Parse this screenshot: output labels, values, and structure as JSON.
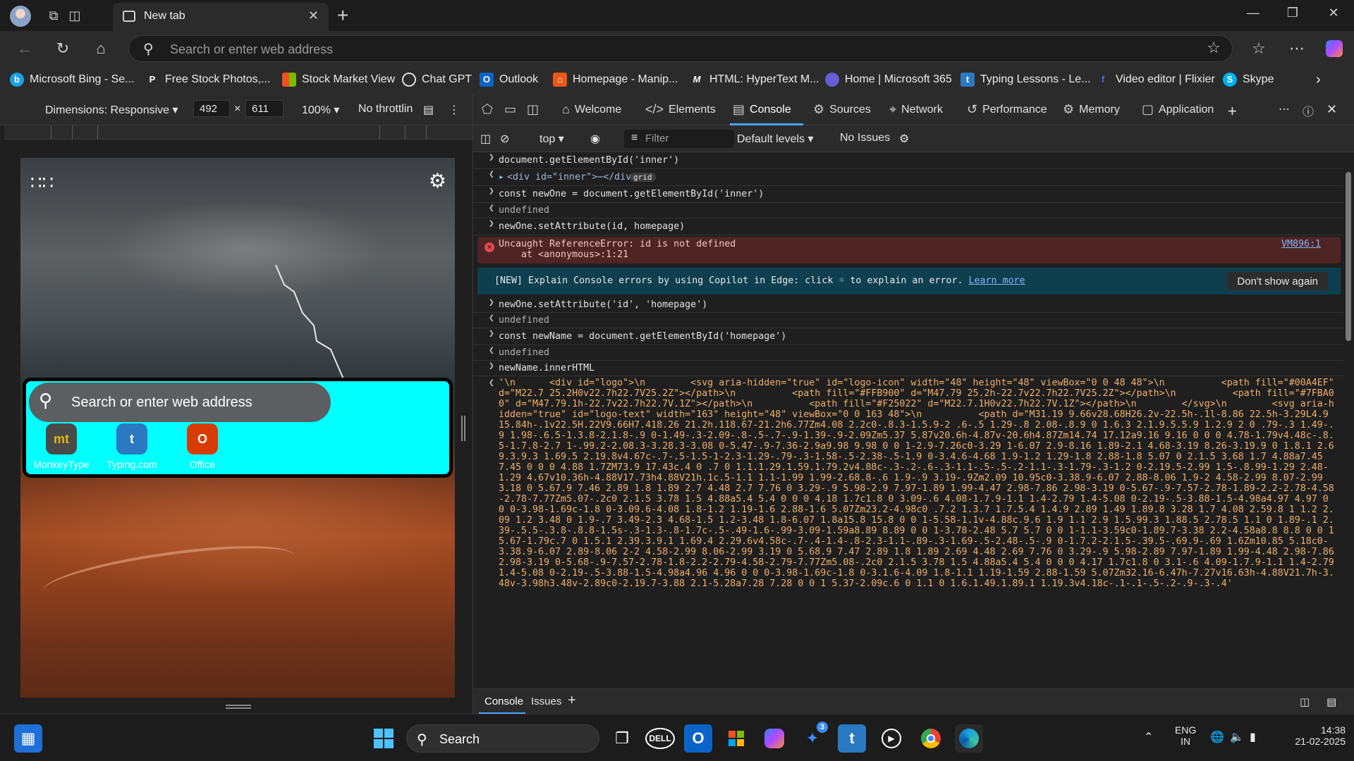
{
  "browser": {
    "tab_title": "New tab",
    "address_placeholder": "Search or enter web address"
  },
  "favorites": [
    {
      "label": "Microsoft Bing - Se...",
      "icon": "bing-icon",
      "color": "#1aa0e8"
    },
    {
      "label": "Free Stock Photos,...",
      "icon": "pexels-icon",
      "color": "#ffffff"
    },
    {
      "label": "Stock Market View",
      "icon": "microsoft-icon",
      "color": "#f25022"
    },
    {
      "label": "Chat GPT",
      "icon": "openai-icon",
      "color": "#ffffff"
    },
    {
      "label": "Outlook",
      "icon": "outlook-icon",
      "color": "#0a64c8"
    },
    {
      "label": "Homepage - Manip...",
      "icon": "homepage-icon",
      "color": "#e8591a"
    },
    {
      "label": "HTML: HyperText M...",
      "icon": "mdn-icon",
      "color": "#000000"
    },
    {
      "label": "Home | Microsoft 365",
      "icon": "m365-icon",
      "color": "#6b5bd6"
    },
    {
      "label": "Typing Lessons - Le...",
      "icon": "typing-icon",
      "color": "#2b79c2"
    },
    {
      "label": "Video editor | Flixier",
      "icon": "flixier-icon",
      "color": "#3b6cf6"
    },
    {
      "label": "Skype",
      "icon": "skype-icon",
      "color": "#00aff0"
    }
  ],
  "device_toolbar": {
    "dimensions_label": "Dimensions: Responsive",
    "width": "492",
    "height": "611",
    "zoom": "100%",
    "throttle": "No throttlin"
  },
  "newtab_page": {
    "search_placeholder": "Search or enter web address",
    "shortcuts": [
      {
        "label": "MonkeyType",
        "glyph": "mt",
        "color": "#e2b714"
      },
      {
        "label": "Typing.com",
        "glyph": "t",
        "color": "#2b79c2"
      },
      {
        "label": "Office",
        "glyph": "O",
        "color": "#d83b01"
      }
    ]
  },
  "devtools": {
    "tabs": [
      "Welcome",
      "Elements",
      "Console",
      "Sources",
      "Network",
      "Performance",
      "Memory",
      "Application"
    ],
    "active_tab": "Console",
    "context": "top",
    "filter_placeholder": "Filter",
    "levels": "Default levels",
    "issues": "No Issues",
    "drawer_tabs": [
      "Console",
      "Issues"
    ],
    "accent": "#4aa3ff"
  },
  "console": {
    "line1": "document.getElementById('inner')",
    "line2": "<div id=\"inner\">⋯</div>",
    "line2_badge": "grid",
    "line3": "const newOne = document.getElementById('inner')",
    "undefined": "undefined",
    "line5": "newOne.setAttribute(id, homepage)",
    "error_msg": "Uncaught ReferenceError: id is not defined",
    "error_at": "    at <anonymous>:1:21",
    "error_link": "VM896:1",
    "copilot_text": "[NEW] Explain Console errors by using Copilot in Edge: click",
    "copilot_text2": "to explain an error.",
    "copilot_link": "Learn more",
    "copilot_button": "Don't show again",
    "line7": "newOne.setAttribute('id', 'homepage')",
    "line9": "const newName = document.getElementById('homepage')",
    "line11": "newName.innerHTML",
    "output": "'\\n      <div id=\"logo\">\\n        <svg aria-hidden=\"true\" id=\"logo-icon\" width=\"48\" height=\"48\" viewBox=\"0 0 48 48\">\\n          <path fill=\"#00A4EF\" d=\"M22.7 25.2H0v22.7h22.7V25.2Z\"></path>\\n          <path fill=\"#FFB900\" d=\"M47.79 25.2h-22.7v22.7h22.7V25.2Z\"></path>\\n          <path fill=\"#7FBA00\" d=\"M47.79.1h-22.7v22.7h22.7V.1Z\"></path>\\n          <path fill=\"#F25022\" d=\"M22.7.1H0v22.7h22.7V.1Z\"></path>\\n        </svg>\\n        <svg aria-hidden=\"true\" id=\"logo-text\" width=\"163\" height=\"48\" viewBox=\"0 0 163 48\">\\n          <path d=\"M31.19 9.66v28.68H26.2v-22.5h-.1l-8.86 22.5h-3.29L4.9 15.84h-.1v22.5H.22V9.66H7.418.26 21.2h.118.67-21.2h6.77Zm4.08 2.2c0-.8.3-1.5.9-2 .6-.5 1.29-.8 2.08-.8.9 0 1.6.3 2.1.9.5.5.9 1.2.9 2 0 .79-.3 1.49-.9 1.98-.6.5-1.3.8-2.1.8-.9 0-1.49-.3-2.09-.8-.5-.7-.9-1.39-.9-2.09Zm5.37 5.87v20.6h-4.87v-20.6h4.87Zm14.74 17.12a9.16 9.16 0 0 0 4.78-1.79v4.48c-.8.5-1.7.8-2.7 1-.99.2-2.08.3-3.28.3-3.08 0-5.47-.9-7.36-2.9a9.98 9.98 0 0 1-2.9-7.26c0-3.29 1-6.07 2.9-8.16 1.89-2.1 4.68-3.19 8.26-3.19.9 0 1.8.1 2.69.3.9.3 1.69.5 2.19.8v4.67c-.7-.5-1.5-1-2.3-1.29-.79-.3-1.58-.5-2.38-.5-1.9 0-3.4.6-4.68 1.9-1.2 1.29-1.8 2.88-1.8 5.07 0 2.1.5 3.68 1.7 4.88a7.45 7.45 0 0 0 4.88 1.7ZM73.9 17.43c.4 0 .7 0 1.1.1.29.1.59.1.79.2v4.88c-.3-.2-.6-.3-1.1-.5-.5-.2-1.1-.3-1.79-.3-1.2 0-2.19.5-2.99 1.5-.8.99-1.29 2.48-1.29 4.67v10.36h-4.88V17.73h4.88V21h.1c.5-1.1 1.1-1.99 1.99-2.68.8-.6 1.9-.9 3.19-.9Zm2.09 10.95c0-3.38.9-6.07 2.88-8.06 1.9-2 4.58-2.99 8.07-2.99 3.18 0 5.67.9 7.46 2.89 1.8 1.89 2.7 4.48 2.7 7.76 0 3.29-.9 5.98-2.9 7.97-1.89 1.99-4.47 2.98-7.86 2.98-3.19 0-5.67-.9-7.57-2.78-1.89-2.2-2.78-4.58-2.78-7.77Zm5.07-.2c0 2.1.5 3.78 1.5 4.88a5.4 5.4 0 0 0 4.18 1.7c1.8 0 3.09-.6 4.08-1.7.9-1.1 1.4-2.79 1.4-5.08 0-2.19-.5-3.88-1.5-4.98a4.97 4.97 0 0 0-3.98-1.69c-1.8 0-3.09.6-4.08 1.8-1.2 1.19-1.6 2.88-1.6 5.07Zm23.2-4.98c0 .7.2 1.3.7 1.7.5.4 1.4.9 2.89 1.49 1.89.8 3.28 1.7 4.08 2.59.8 1 1.2 2.09 1.2 3.48 0 1.9-.7 3.49-2.3 4.68-1.5 1.2-3.48 1.8-6.07 1.8a15.8 15.8 0 0 1-5.58-1.1v-4.88c.9.6 1.9 1.1 2.9 1.5.99.3 1.88.5 2.78.5 1.1 0 1.89-.1 2.39-.5.5-.3.8-.8.8-1.5s-.3-1.3-.8-1.7c-.5-.49-1.6-.99-3.09-1.59a8.89 8.89 0 0 1-3.78-2.48 5.7 5.7 0 0 1-1.1-3.59c0-1.89.7-3.38 2.2-4.58a8.8 8.8 0 0 1 5.67-1.79c.7 0 1.5.1 2.39.3.9.1 1.69.4 2.29.6v4.58c-.7-.4-1.4-.8-2.3-1.1-.89-.3-1.69-.5-2.48-.5-.9 0-1.7.2-2.1.5-.39.5-.69.9-.69 1.6Zm10.85 5.18c0-3.38.9-6.07 2.89-8.06 2-2 4.58-2.99 8.06-2.99 3.19 0 5.68.9 7.47 2.89 1.8 1.89 2.69 4.48 2.69 7.76 0 3.29-.9 5.98-2.89 7.97-1.89 1.99-4.48 2.98-7.86 2.98-3.19 0-5.68-.9-7.57-2.78-1.8-2.2-2.79-4.58-2.79-7.77Zm5.08-.2c0 2.1.5 3.78 1.5 4.88a5.4 5.4 0 0 0 4.17 1.7c1.8 0 3.1-.6 4.09-1.7.9-1.1 1.4-2.79 1.4-5.08 0-2.19-.5-3.88-1.5-4.98a4.96 4.96 0 0 0-3.98-1.69c-1.8 0-3.1.6-4.09 1.8-1.1 1.19-1.59 2.88-1.59 5.07Zm32.16-6.47h-7.27v16.63h-4.88V21.7h-3.48v-3.98h3.48v-2.89c0-2.19.7-3.88 2.1-5.28a7.28 7.28 0 0 1 5.37-2.09c.6 0 1.1 0 1.6.1.49.1.89.1 1.19.3v4.18c-.1-.1-.5-.2-.9-.3-.4'"
  },
  "taskbar": {
    "search_label": "Search",
    "lang_top": "ENG",
    "lang_bottom": "IN",
    "time": "14:38",
    "date": "21-02-2025",
    "badge": "3"
  }
}
